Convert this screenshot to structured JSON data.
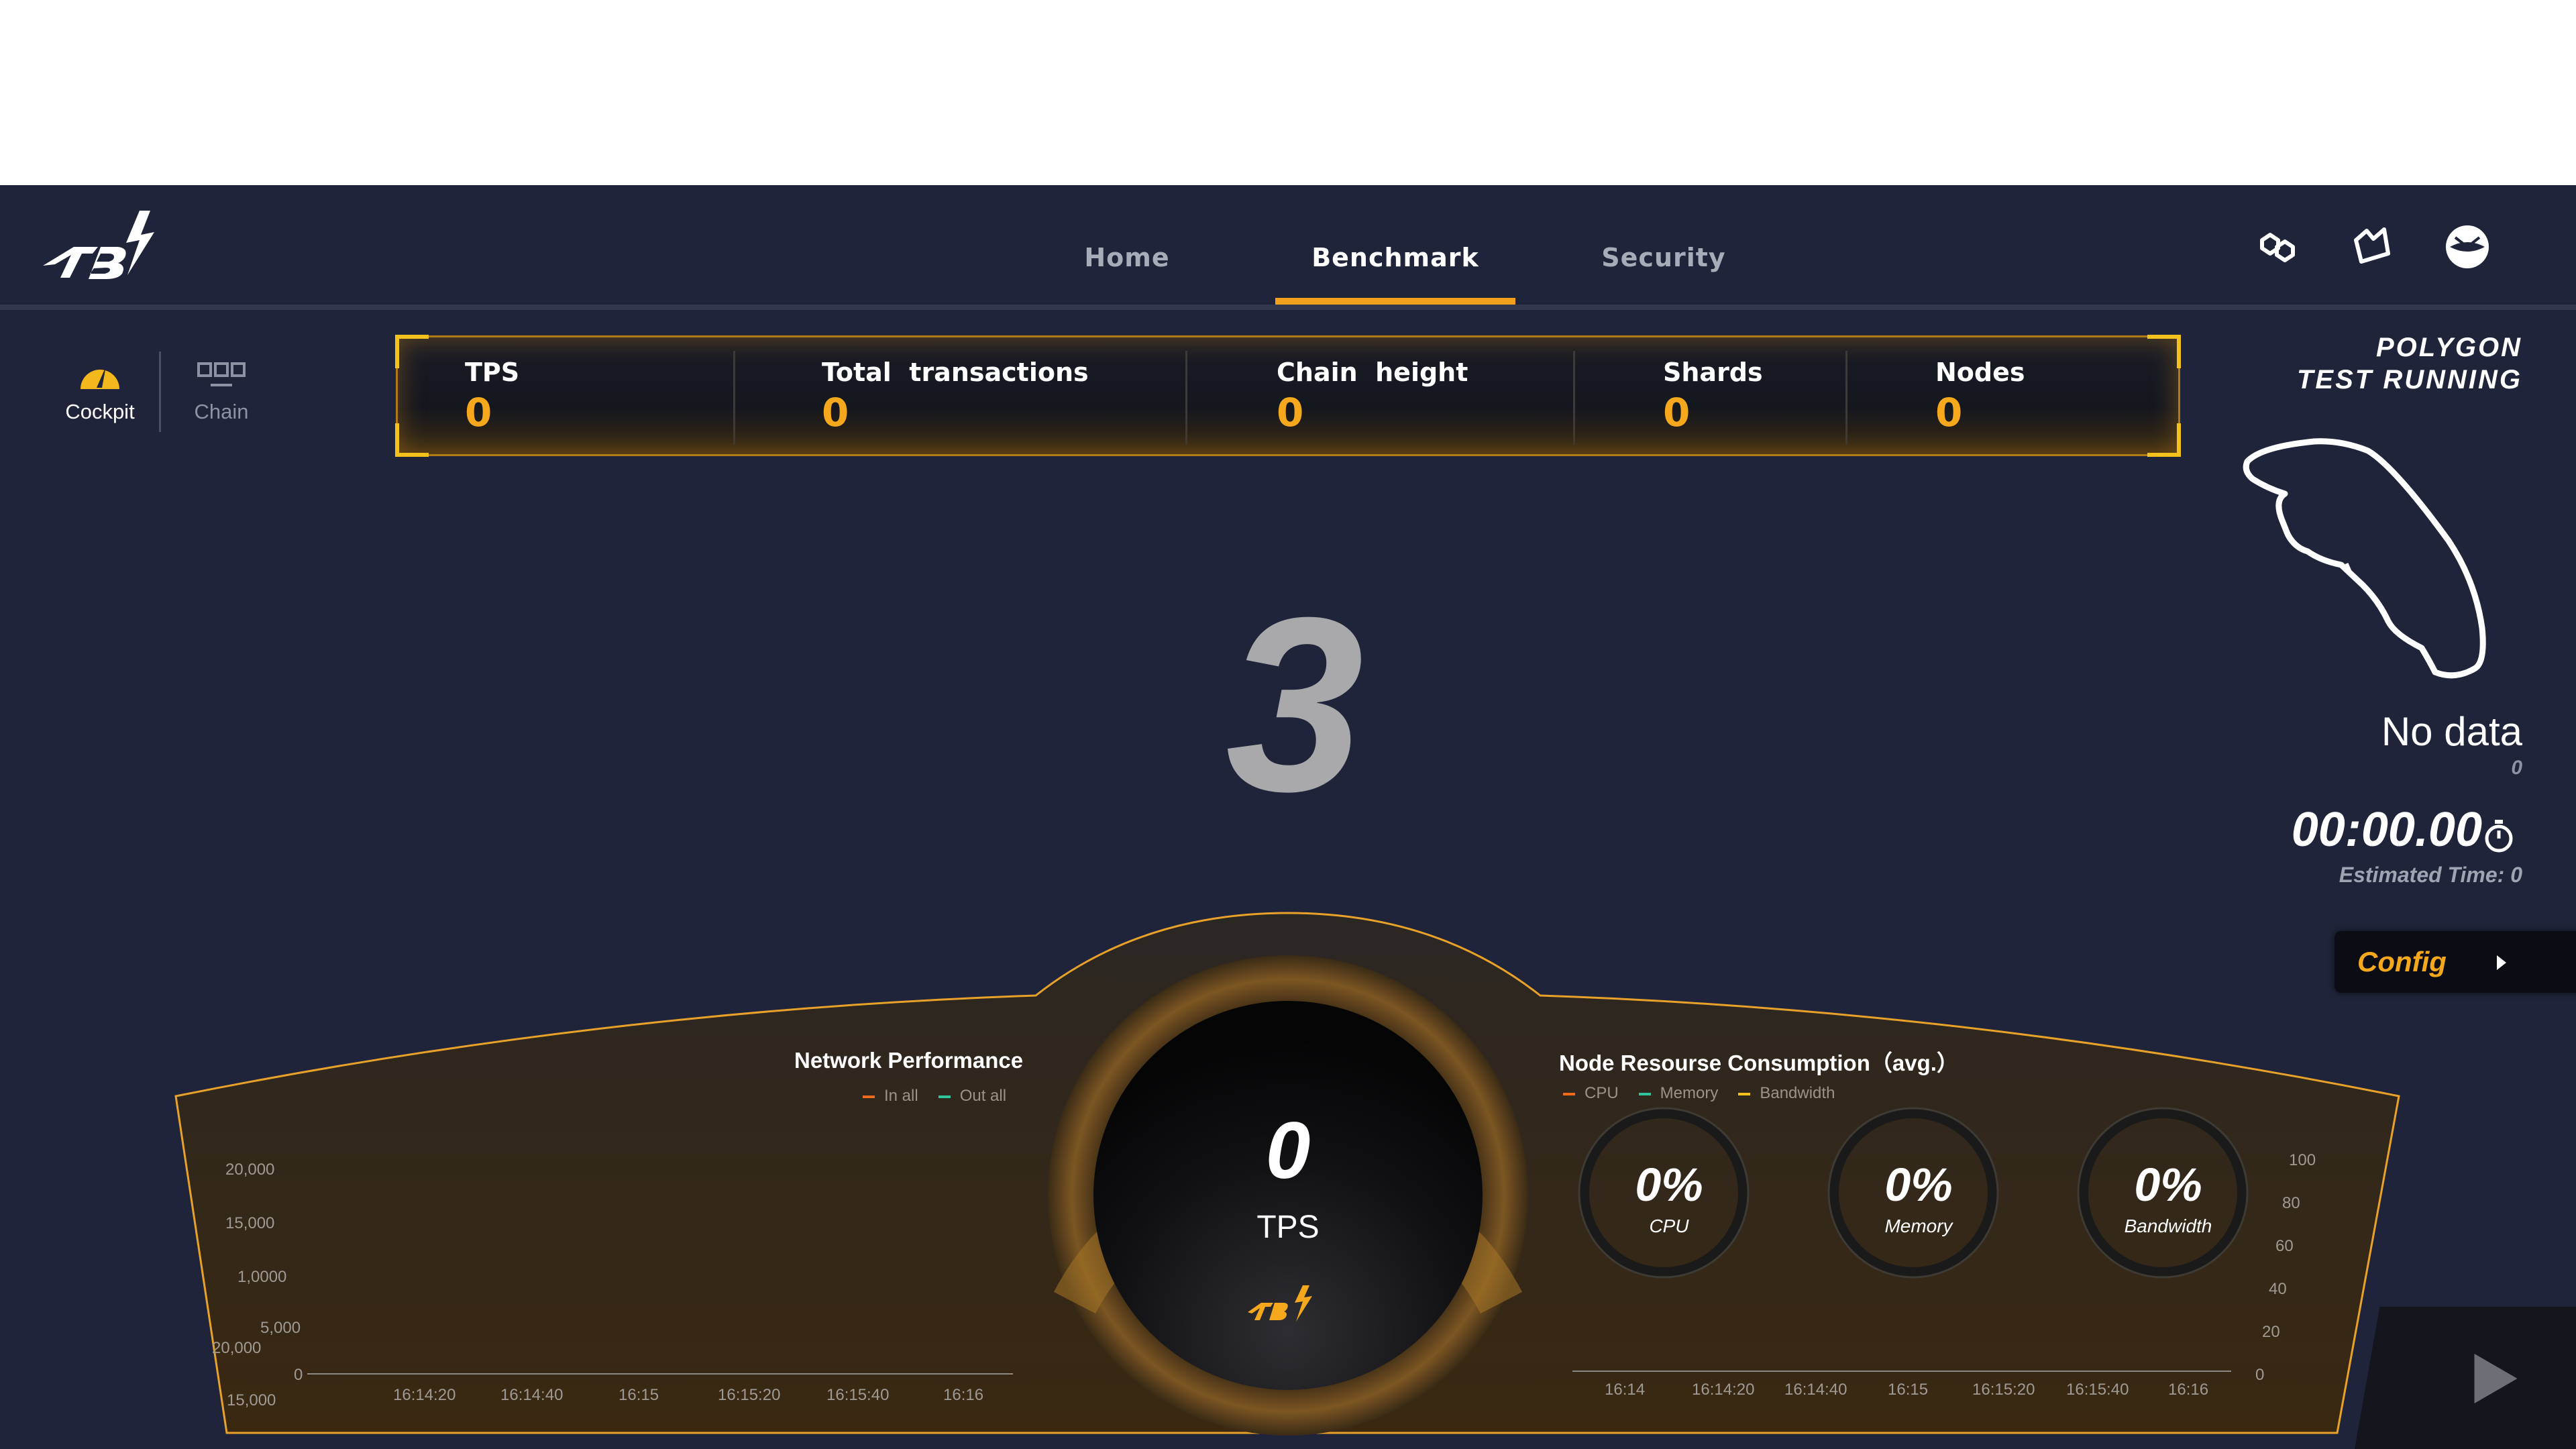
{
  "header": {
    "nav": [
      {
        "label": "Home",
        "active": false
      },
      {
        "label": "Benchmark",
        "active": true
      },
      {
        "label": "Security",
        "active": false
      }
    ],
    "icons": [
      "chainlink-icon",
      "crown-icon",
      "avatar-icon"
    ]
  },
  "sidebar": {
    "tabs": [
      {
        "label": "Cockpit",
        "icon": "speedometer-icon",
        "active": true
      },
      {
        "label": "Chain",
        "icon": "blocks-icon",
        "active": false
      }
    ]
  },
  "stats": [
    {
      "label": "TPS",
      "value": "0"
    },
    {
      "label": "Total  transactions",
      "value": "0"
    },
    {
      "label": "Chain  height",
      "value": "0"
    },
    {
      "label": "Shards",
      "value": "0"
    },
    {
      "label": "Nodes",
      "value": "0"
    }
  ],
  "countdown": "3",
  "right_panel": {
    "network_line1": "POLYGON",
    "network_line2": "TEST RUNNING",
    "track_status": "No data",
    "track_sub": "0",
    "timer": "00:00.00",
    "estimated": "Estimated Time: 0",
    "config_label": "Config"
  },
  "network_performance": {
    "title": "Network Performance",
    "legend": [
      {
        "name": "In all",
        "color": "#f26a1b"
      },
      {
        "name": "Out all",
        "color": "#2fc49b"
      }
    ],
    "yticks": [
      "20,000",
      "15,000",
      "1,0000",
      "5,000",
      "0"
    ],
    "xticks": [
      "16:14:20",
      "16:14:40",
      "16:15",
      "16:15:20",
      "16:15:40",
      "16:16"
    ]
  },
  "gauge": {
    "value": "0",
    "label": "TPS"
  },
  "node_resources": {
    "title": "Node Resourse Consumption（avg.）",
    "legend": [
      {
        "name": "CPU",
        "color": "#f26a1b"
      },
      {
        "name": "Memory",
        "color": "#2fc49b"
      },
      {
        "name": "Bandwidth",
        "color": "#f3c21c"
      }
    ],
    "rings": [
      {
        "value": "0%",
        "label": "CPU"
      },
      {
        "value": "0%",
        "label": "Memory"
      },
      {
        "value": "0%",
        "label": "Bandwidth"
      }
    ],
    "yticks": [
      "100",
      "80",
      "60",
      "40",
      "20",
      "0"
    ],
    "xticks": [
      "16:14",
      "16:14:20",
      "16:14:40",
      "16:15",
      "16:15:20",
      "16:15:40",
      "16:16"
    ]
  },
  "colors": {
    "accent": "#f3a11c",
    "background": "#20243a",
    "value": "#f5a81c"
  }
}
